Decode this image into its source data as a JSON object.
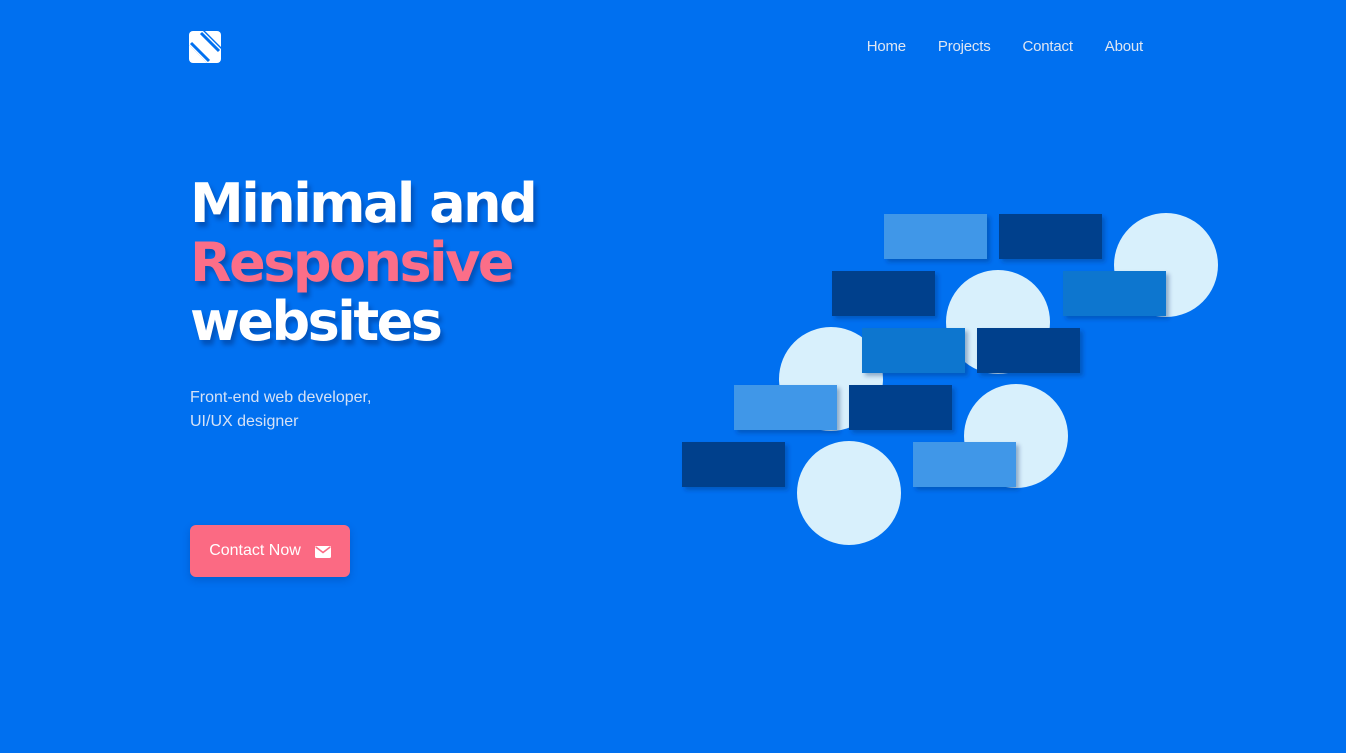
{
  "header": {
    "logo_icon": "brand-logo-icon",
    "nav": [
      {
        "label": "Home"
      },
      {
        "label": "Projects"
      },
      {
        "label": "Contact"
      },
      {
        "label": "About"
      }
    ]
  },
  "hero": {
    "headline": {
      "line1": "Minimal and",
      "line2": "Responsive",
      "line3": "websites"
    },
    "subtitle": {
      "line1": "Front-end web developer,",
      "line2": "UI/UX designer"
    },
    "cta": {
      "label": "Contact Now",
      "icon": "envelope-icon"
    }
  },
  "colors": {
    "background": "#0070f0",
    "accent": "#fb6a83",
    "headline": "#ffffff",
    "tile_light": "#3f97e8",
    "tile_dark": "#053f8c",
    "tile_mid": "#0876cf",
    "circle": "#d8f0fc"
  }
}
